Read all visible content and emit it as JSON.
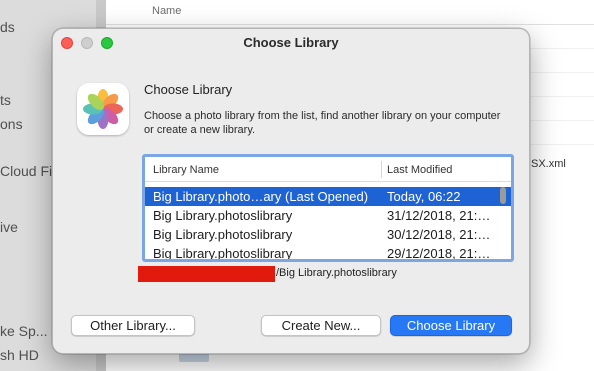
{
  "background": {
    "sidebar_items": [
      "ds",
      "ts",
      "ons",
      "Cloud Fi",
      "ive",
      "ke Sp...",
      "sh HD"
    ],
    "column_header": "Name",
    "visible_file": "SX.xml"
  },
  "dialog": {
    "title": "Choose Library",
    "heading": "Choose Library",
    "description": "Choose a photo library from the list, find another library on your computer or create a new library.",
    "app_icon": "photos-app-icon"
  },
  "library_table": {
    "columns": [
      "Library Name",
      "Last Modified"
    ],
    "rows": [
      {
        "name": "Big Library.photo…ary (Last Opened)",
        "modified": "Today, 06:22",
        "selected": true
      },
      {
        "name": "Big Library.photoslibrary",
        "modified": "31/12/2018, 21:…",
        "selected": false
      },
      {
        "name": "Big Library.photoslibrary",
        "modified": "30/12/2018, 21:…",
        "selected": false
      },
      {
        "name": "Big Library.photoslibrary",
        "modified": "29/12/2018, 21:…",
        "selected": false
      }
    ]
  },
  "selected_path": "/Big Library.photoslibrary",
  "buttons": {
    "other_library": "Other Library...",
    "create_new": "Create New...",
    "choose_library": "Choose Library"
  },
  "colors": {
    "accent": "#2778f5",
    "selection": "#1e63d3",
    "table_focus_ring": "#7aa7e3",
    "redaction": "#e01a0d",
    "traffic_close": "#fe5f57",
    "traffic_max": "#28c840"
  }
}
